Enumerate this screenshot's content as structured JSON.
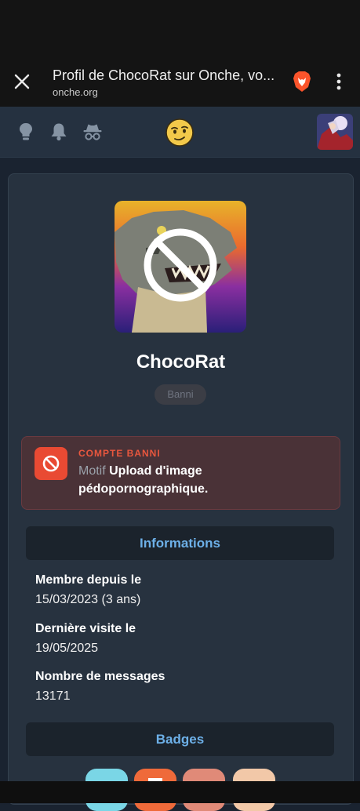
{
  "browser": {
    "title": "Profil de ChocoRat sur Onche, vo...",
    "domain": "onche.org"
  },
  "icons": {
    "close": "close-icon",
    "brave": "brave-lion-icon",
    "menu": "kebab-menu-icon",
    "lightbulb": "lightbulb-icon",
    "bell": "bell-icon",
    "incognito": "incognito-icon",
    "mascot": "smiley-mascot-icon",
    "ban": "ban-icon"
  },
  "profile": {
    "username": "ChocoRat",
    "role": "Banni"
  },
  "ban": {
    "title": "COMPTE BANNI",
    "motif_label": "Motif",
    "reason": "Upload d'image pédopornographique."
  },
  "informations": {
    "heading": "Informations",
    "items": [
      {
        "label": "Membre depuis le",
        "value": "15/03/2023 (3 ans)"
      },
      {
        "label": "Dernière visite le",
        "value": "19/05/2025"
      },
      {
        "label": "Nombre de messages",
        "value": "13171"
      }
    ]
  },
  "badges": {
    "heading": "Badges"
  },
  "colors": {
    "accent": "#6db0e8",
    "ban_red": "#e94a33",
    "card_bg": "#27323f"
  }
}
